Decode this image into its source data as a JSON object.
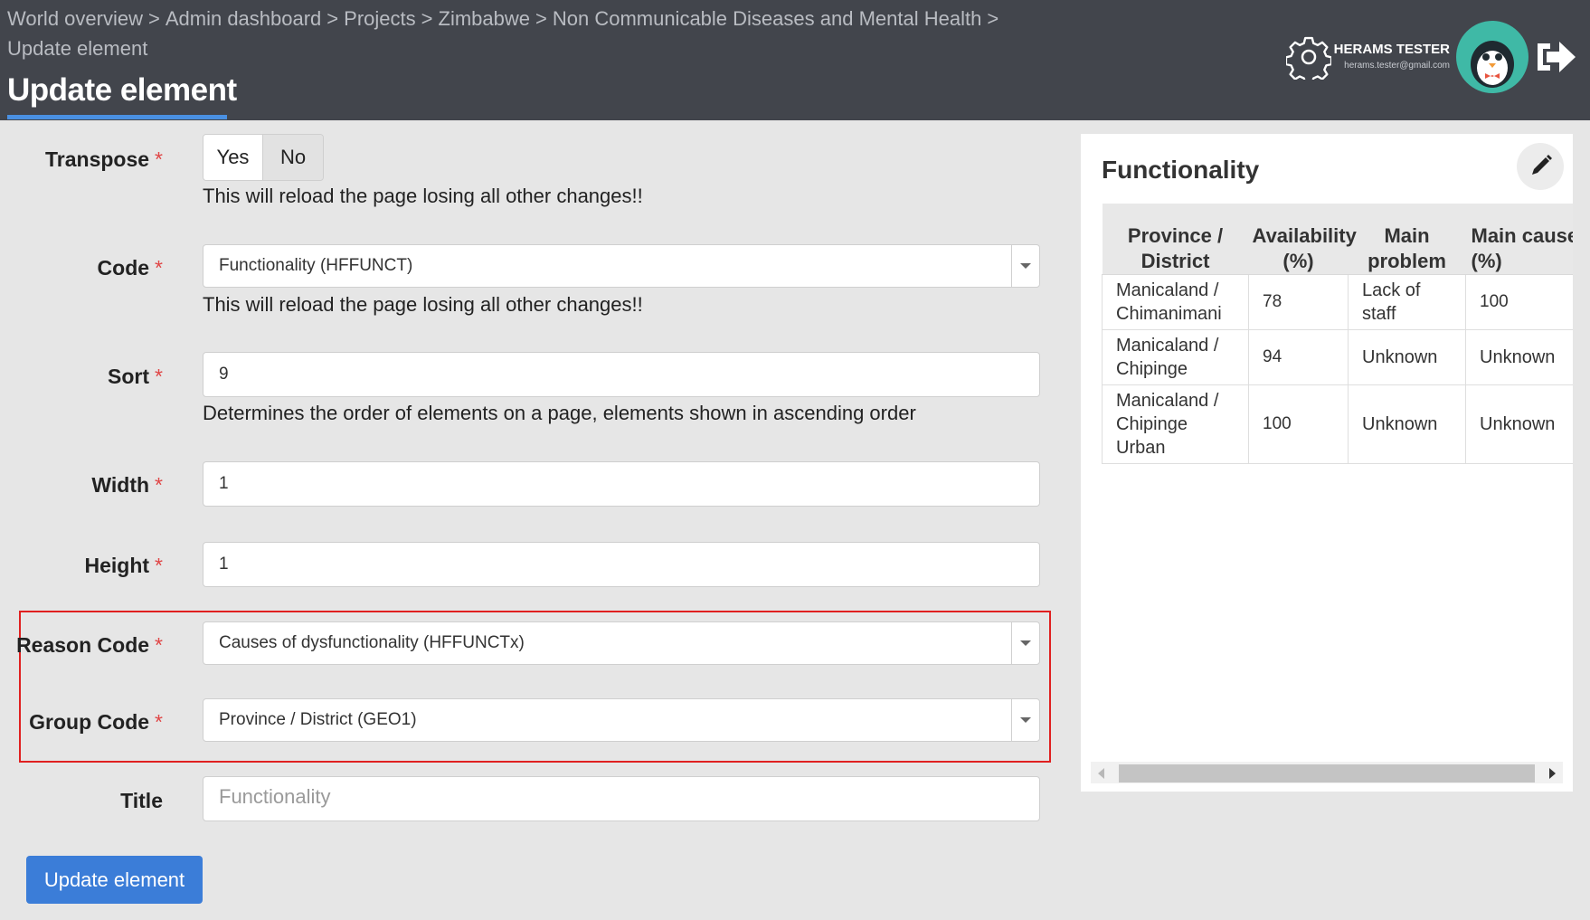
{
  "breadcrumb": {
    "items": [
      "World overview",
      "Admin dashboard",
      "Projects",
      "Zimbabwe",
      "Non Communicable Diseases and Mental Health",
      "Update element"
    ]
  },
  "page": {
    "title": "Update element"
  },
  "user": {
    "name": "HERAMS TESTER",
    "email": "herams.tester@gmail.com"
  },
  "icons": {
    "settings": "gear-icon",
    "avatar": "penguin-avatar",
    "logout": "logout-icon",
    "edit": "pencil-icon"
  },
  "colors": {
    "topbar": "#42454c",
    "accent": "#3b7dd8",
    "highlight": "#e02020",
    "avatar_bg": "#3fb9a6"
  },
  "form": {
    "required_mark": "*",
    "transpose": {
      "label": "Transpose",
      "yes": "Yes",
      "no": "No",
      "selected": "No",
      "help": "This will reload the page losing all other changes!!"
    },
    "code": {
      "label": "Code",
      "value": "Functionality (HFFUNCT)",
      "help": "This will reload the page losing all other changes!!"
    },
    "sort": {
      "label": "Sort",
      "value": "9",
      "help": "Determines the order of elements on a page, elements shown in ascending order"
    },
    "width": {
      "label": "Width",
      "value": "1"
    },
    "height": {
      "label": "Height",
      "value": "1"
    },
    "reason_code": {
      "label": "Reason Code",
      "value": "Causes of dysfunctionality (HFFUNCTx)"
    },
    "group_code": {
      "label": "Group Code",
      "value": "Province / District (GEO1)"
    },
    "title": {
      "label": "Title",
      "placeholder": "Functionality"
    },
    "submit_label": "Update element"
  },
  "preview": {
    "title": "Functionality",
    "columns": [
      "Province / District",
      "Availability (%)",
      "Main problem",
      "Main cause (%)"
    ],
    "rows": [
      [
        "Manicaland / Chimanimani",
        "78",
        "Lack of staff",
        "100"
      ],
      [
        "Manicaland / Chipinge",
        "94",
        "Unknown",
        "Unknown"
      ],
      [
        "Manicaland / Chipinge Urban",
        "100",
        "Unknown",
        "Unknown"
      ]
    ]
  }
}
